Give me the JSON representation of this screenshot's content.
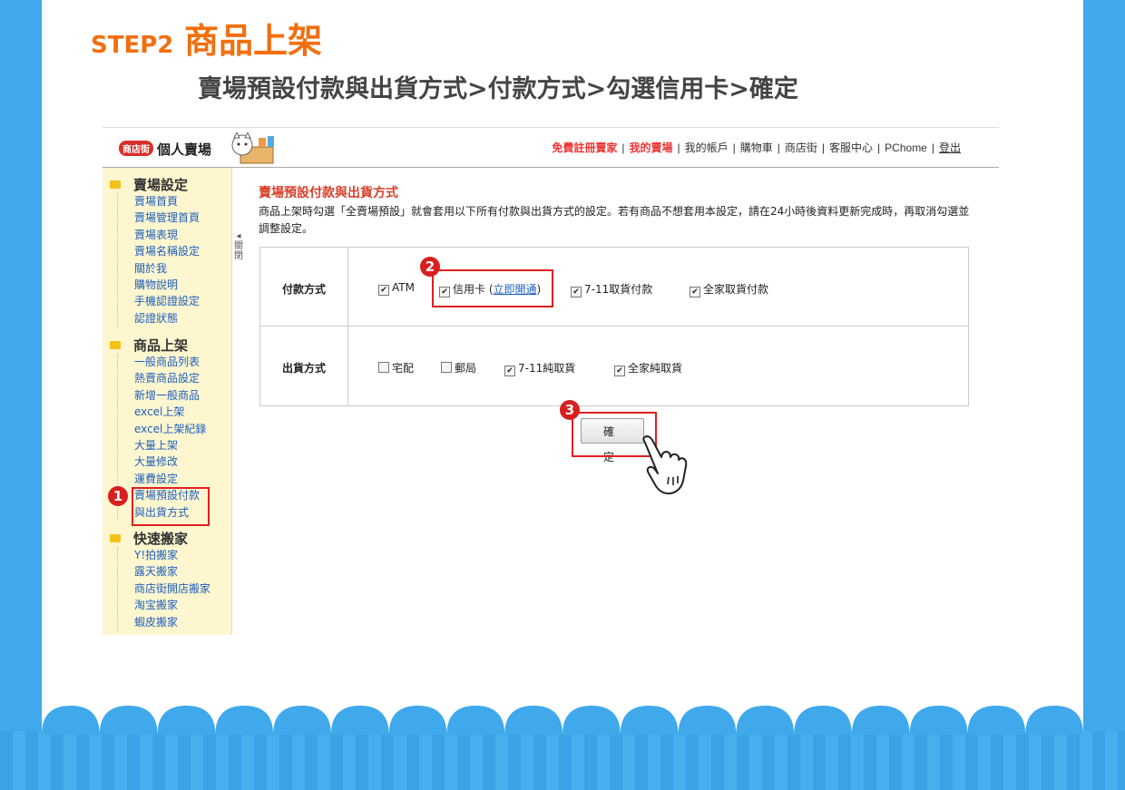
{
  "heading": {
    "step": "STEP2",
    "title": "商品上架",
    "subtitle": "賣場預設付款與出貨方式>付款方式>勾選信用卡>確定"
  },
  "topbar": {
    "logo_badge": "商店街",
    "logo_text": "個人賣場",
    "links": [
      "免費註冊賣家",
      "我的賣場",
      "我的帳戶",
      "購物車",
      "商店街",
      "客服中心",
      "PChome",
      "登出"
    ]
  },
  "sidebar": {
    "groups": [
      {
        "title": "賣場設定",
        "items": [
          "賣場首頁",
          "賣場管理首頁",
          "賣場表現",
          "賣場名稱設定",
          "關於我",
          "購物說明",
          "手機認證設定",
          "認證狀態"
        ]
      },
      {
        "title": "商品上架",
        "items": [
          "一般商品列表",
          "熱賣商品設定",
          "新增一般商品",
          "excel上架",
          "excel上架紀錄",
          "大量上架",
          "大量修改",
          "運費設定",
          "賣場預設付款",
          "與出貨方式"
        ]
      },
      {
        "title": "快速搬家",
        "items": [
          "Y!拍搬家",
          "露天搬家",
          "商店街開店搬家",
          "淘宝搬家",
          "蝦皮搬家"
        ]
      }
    ],
    "collapse_label": "◂ 關 閉"
  },
  "content": {
    "title": "賣場預設付款與出貨方式",
    "description": "商品上架時勾選「全賣場預設」就會套用以下所有付款與出貨方式的設定。若有商品不想套用本設定，請在24小時後資料更新完成時，再取消勾選並調整設定。",
    "payment": {
      "label": "付款方式",
      "options": [
        {
          "text": "ATM",
          "checked": true
        },
        {
          "text": "信用卡",
          "checked": true,
          "link": "立即開通"
        },
        {
          "text": "7-11取貨付款",
          "checked": true
        },
        {
          "text": "全家取貨付款",
          "checked": true
        }
      ]
    },
    "shipping": {
      "label": "出貨方式",
      "options": [
        {
          "text": "宅配",
          "checked": false
        },
        {
          "text": "郵局",
          "checked": false
        },
        {
          "text": "7-11純取貨",
          "checked": true
        },
        {
          "text": "全家純取貨",
          "checked": true
        }
      ]
    },
    "confirm_label": "確定"
  },
  "markers": [
    "1",
    "2",
    "3"
  ],
  "colors": {
    "accent_orange": "#f26f0f",
    "frame_blue": "#3fa9ec",
    "highlight_red": "#e02020"
  }
}
